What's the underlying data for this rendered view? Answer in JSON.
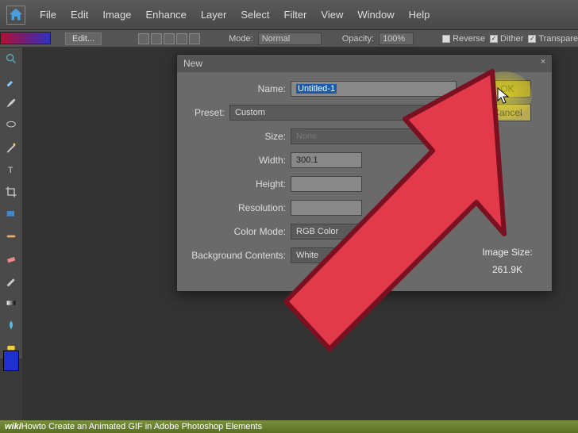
{
  "menu": {
    "file": "File",
    "edit": "Edit",
    "image": "Image",
    "enhance": "Enhance",
    "layer": "Layer",
    "select": "Select",
    "filter": "Filter",
    "view": "View",
    "window": "Window",
    "help": "Help"
  },
  "options": {
    "edit": "Edit...",
    "mode_label": "Mode:",
    "mode_value": "Normal",
    "opacity_label": "Opacity:",
    "opacity_value": "100%",
    "reverse": "Reverse",
    "dither": "Dither",
    "transparency": "Transparency"
  },
  "dialog": {
    "title": "New",
    "name_label": "Name:",
    "name_value": "Untitled-1",
    "preset_label": "Preset:",
    "preset_value": "Custom",
    "size_label": "Size:",
    "size_value": "None",
    "width_label": "Width:",
    "width_value": "300.1",
    "height_label": "Height:",
    "resolution_label": "Resolution:",
    "colormode_label": "Color Mode:",
    "colormode_value": "RGB Color",
    "bg_label": "Background Contents:",
    "bg_value": "White",
    "ok": "OK",
    "cancel": "Cancel",
    "image_size_label": "Image Size:",
    "image_size_value": "261.9K"
  },
  "footer": {
    "prefix": "wiki",
    "how": "How ",
    "text": "to Create an Animated GIF in Adobe Photoshop Elements"
  }
}
